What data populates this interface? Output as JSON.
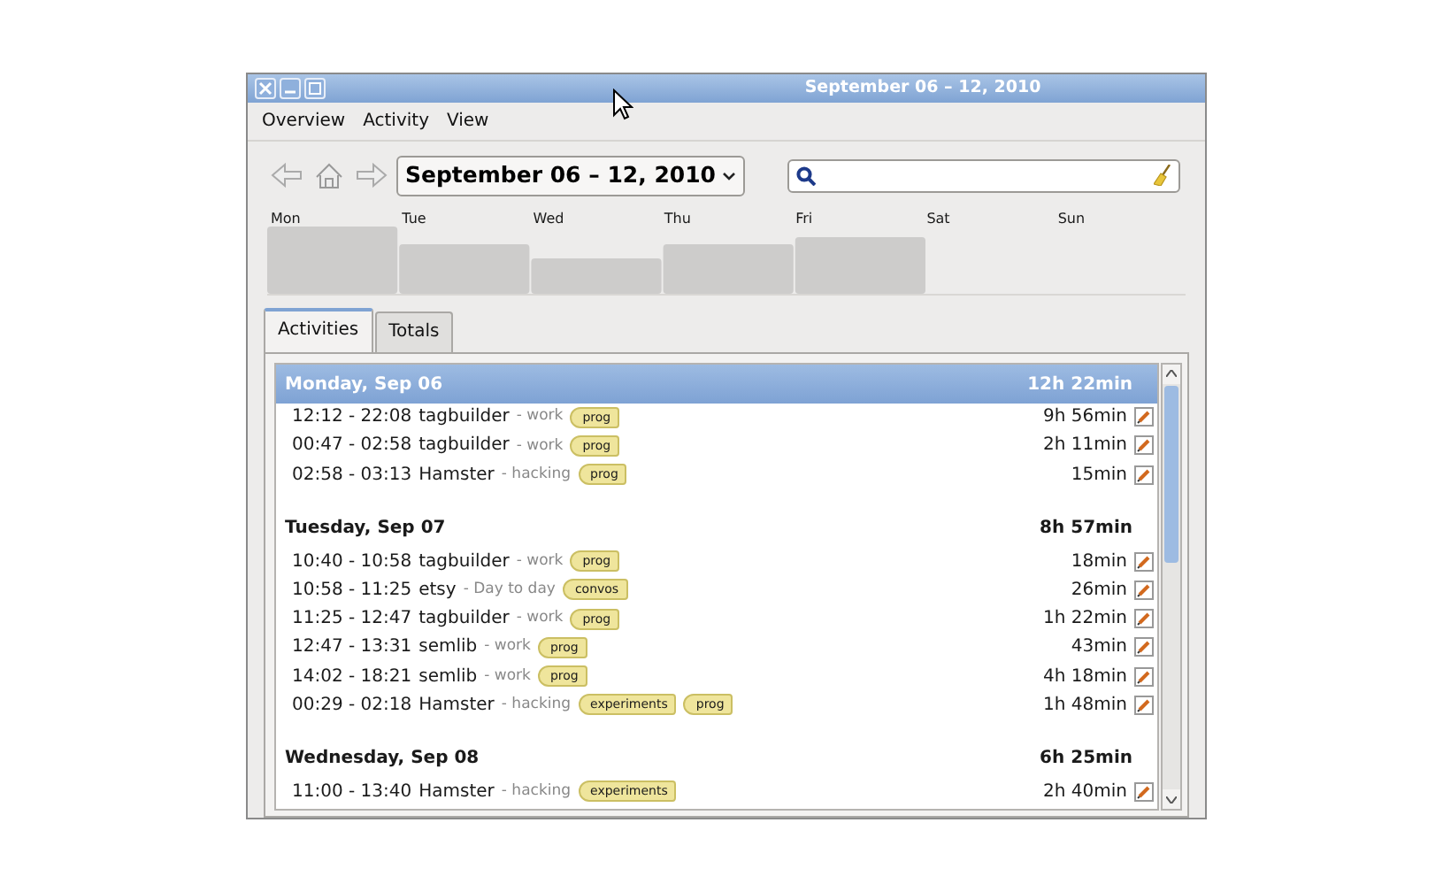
{
  "window": {
    "title": "September 06 – 12, 2010"
  },
  "menu": [
    "Overview",
    "Activity",
    "View"
  ],
  "toolbar": {
    "date_range": "September 06 – 12, 2010"
  },
  "week_chart": {
    "days": [
      "Mon",
      "Tue",
      "Wed",
      "Thu",
      "Fri",
      "Sat",
      "Sun"
    ]
  },
  "tabs": [
    {
      "label": "Activities",
      "selected": true
    },
    {
      "label": "Totals",
      "selected": false
    }
  ],
  "days": [
    {
      "title": "Monday, Sep 06",
      "total": "12h 22min",
      "selected": true,
      "activities": [
        {
          "time": "12:12 - 22:08",
          "name": "tagbuilder",
          "category": "- work",
          "tags": [
            "prog"
          ],
          "duration": "9h 56min"
        },
        {
          "time": "00:47 - 02:58",
          "name": "tagbuilder",
          "category": "- work",
          "tags": [
            "prog"
          ],
          "duration": "2h 11min"
        },
        {
          "time": "02:58 - 03:13",
          "name": "Hamster",
          "category": "- hacking",
          "tags": [
            "prog"
          ],
          "duration": "15min"
        }
      ]
    },
    {
      "title": "Tuesday, Sep 07",
      "total": "8h 57min",
      "selected": false,
      "activities": [
        {
          "time": "10:40 - 10:58",
          "name": "tagbuilder",
          "category": "- work",
          "tags": [
            "prog"
          ],
          "duration": "18min"
        },
        {
          "time": "10:58 - 11:25",
          "name": "etsy",
          "category": "- Day to day",
          "tags": [
            "convos"
          ],
          "duration": "26min"
        },
        {
          "time": "11:25 - 12:47",
          "name": "tagbuilder",
          "category": "- work",
          "tags": [
            "prog"
          ],
          "duration": "1h 22min"
        },
        {
          "time": "12:47 - 13:31",
          "name": "semlib",
          "category": "- work",
          "tags": [
            "prog"
          ],
          "duration": "43min"
        },
        {
          "time": "14:02 - 18:21",
          "name": "semlib",
          "category": "- work",
          "tags": [
            "prog"
          ],
          "duration": "4h 18min"
        },
        {
          "time": "00:29 - 02:18",
          "name": "Hamster",
          "category": "- hacking",
          "tags": [
            "experiments",
            "prog"
          ],
          "duration": "1h 48min"
        }
      ]
    },
    {
      "title": "Wednesday, Sep 08",
      "total": "6h 25min",
      "selected": false,
      "activities": [
        {
          "time": "11:00 - 13:40",
          "name": "Hamster",
          "category": "- hacking",
          "tags": [
            "experiments"
          ],
          "duration": "2h 40min"
        }
      ]
    }
  ]
}
